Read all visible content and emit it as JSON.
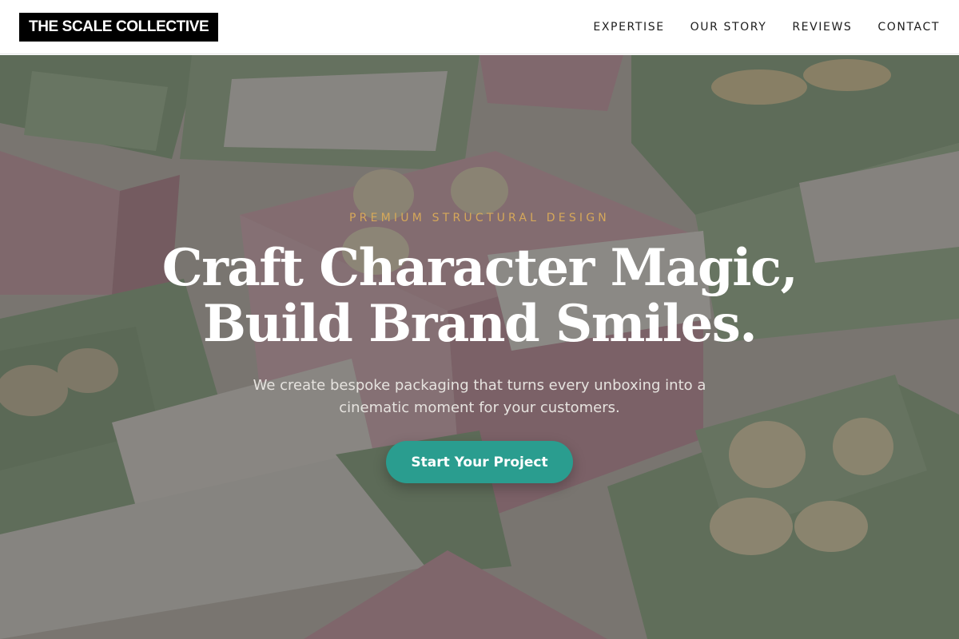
{
  "header": {
    "logo": "THE SCALE COLLECTIVE",
    "nav": [
      {
        "label": "EXPERTISE"
      },
      {
        "label": "OUR STORY"
      },
      {
        "label": "REVIEWS"
      },
      {
        "label": "CONTACT"
      }
    ]
  },
  "hero": {
    "eyebrow": "PREMIUM STRUCTURAL DESIGN",
    "headline_line1": "Craft Character Magic,",
    "headline_line2": "Build Brand Smiles.",
    "subhead_line1": "We create bespoke packaging that turns every unboxing into a",
    "subhead_line2": "cinematic moment for your customers.",
    "cta_label": "Start Your Project",
    "background_image": "soap-packaging-boxes-photo"
  },
  "colors": {
    "accent": "#2a9d8f",
    "eyebrow_gold": "#d6a85a",
    "logo_bg": "#000000",
    "box_green": "#8fb088",
    "box_pink": "#d9a6b2"
  }
}
